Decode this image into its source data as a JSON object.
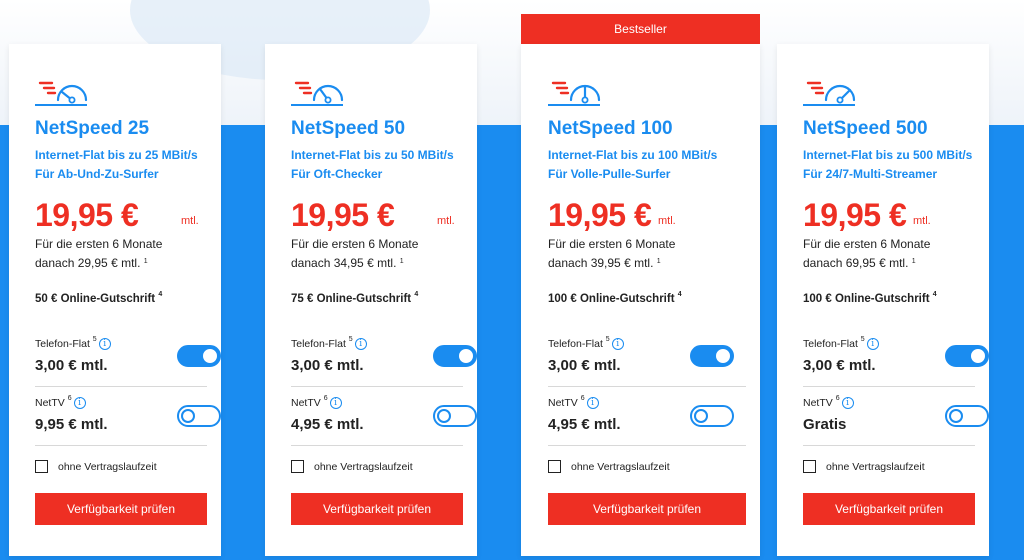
{
  "badge": "Bestseller",
  "colors": {
    "accent_blue": "#1a8cf0",
    "accent_red": "#ee2f23"
  },
  "plans": [
    {
      "name": "NetSpeed 25",
      "desc1": "Internet-Flat bis zu 25 MBit/s",
      "desc2": "Für Ab-Und-Zu-Surfer",
      "price": "19,95 €",
      "price_unit": "mtl.",
      "sub1": "Für die ersten 6 Monate",
      "sub2": "danach 29,95 € mtl.",
      "sub2_sup": "1",
      "credit": "50 € Online-Gutschrift",
      "credit_sup": "4",
      "phone_label": "Telefon-Flat",
      "phone_sup": "5",
      "phone_price": "3,00 € mtl.",
      "phone_on": true,
      "tv_label": "NetTV",
      "tv_sup": "6",
      "tv_price": "9,95 € mtl.",
      "tv_on": false,
      "no_contract": "ohne Vertragslaufzeit",
      "cta": "Verfügbarkeit prüfen",
      "speed_level": 0.15
    },
    {
      "name": "NetSpeed 50",
      "desc1": "Internet-Flat bis zu 50 MBit/s",
      "desc2": "Für Oft-Checker",
      "price": "19,95 €",
      "price_unit": "mtl.",
      "sub1": "Für die ersten 6 Monate",
      "sub2": "danach 34,95 € mtl.",
      "sub2_sup": "1",
      "credit": "75 € Online-Gutschrift",
      "credit_sup": "4",
      "phone_label": "Telefon-Flat",
      "phone_sup": "5",
      "phone_price": "3,00 € mtl.",
      "phone_on": true,
      "tv_label": "NetTV",
      "tv_sup": "6",
      "tv_price": "4,95 € mtl.",
      "tv_on": false,
      "no_contract": "ohne Vertragslaufzeit",
      "cta": "Verfügbarkeit prüfen",
      "speed_level": 0.3
    },
    {
      "name": "NetSpeed 100",
      "desc1": "Internet-Flat bis zu 100 MBit/s",
      "desc2": "Für Volle-Pulle-Surfer",
      "price": "19,95 €",
      "price_unit": "mtl.",
      "sub1": "Für die ersten 6 Monate",
      "sub2": "danach 39,95 € mtl.",
      "sub2_sup": "1",
      "credit": "100 € Online-Gutschrift",
      "credit_sup": "4",
      "phone_label": "Telefon-Flat",
      "phone_sup": "5",
      "phone_price": "3,00 € mtl.",
      "phone_on": true,
      "tv_label": "NetTV",
      "tv_sup": "6",
      "tv_price": "4,95 € mtl.",
      "tv_on": false,
      "no_contract": "ohne Vertragslaufzeit",
      "cta": "Verfügbarkeit prüfen",
      "speed_level": 0.5
    },
    {
      "name": "NetSpeed 500",
      "desc1": "Internet-Flat bis zu 500 MBit/s",
      "desc2": "Für 24/7-Multi-Streamer",
      "price": "19,95 €",
      "price_unit": "mtl.",
      "sub1": "Für die ersten 6 Monate",
      "sub2": "danach 69,95 € mtl.",
      "sub2_sup": "1",
      "credit": "100 € Online-Gutschrift",
      "credit_sup": "4",
      "phone_label": "Telefon-Flat",
      "phone_sup": "5",
      "phone_price": "3,00 € mtl.",
      "phone_on": true,
      "tv_label": "NetTV",
      "tv_sup": "6",
      "tv_price": "Gratis",
      "tv_on": false,
      "no_contract": "ohne Vertragslaufzeit",
      "cta": "Verfügbarkeit prüfen",
      "speed_level": 0.85
    }
  ]
}
